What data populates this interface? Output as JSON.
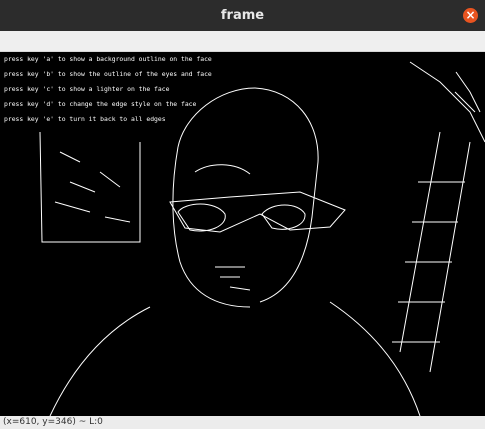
{
  "window": {
    "title": "frame",
    "close_glyph": "×"
  },
  "overlay": {
    "lines": [
      "press key 'a' to show a background outline on the face",
      "press key 'b' to show the outline of the eyes and face",
      "press key 'c' to show a lighter on the face",
      "press key 'd' to change the edge style on the face",
      "press key 'e' to turn it back to all edges"
    ]
  },
  "status": {
    "text": "(x=610, y=346) ~ L:0"
  },
  "colors": {
    "titlebar": "#2c2c2c",
    "close": "#e95420",
    "edges": "#ffffff"
  }
}
